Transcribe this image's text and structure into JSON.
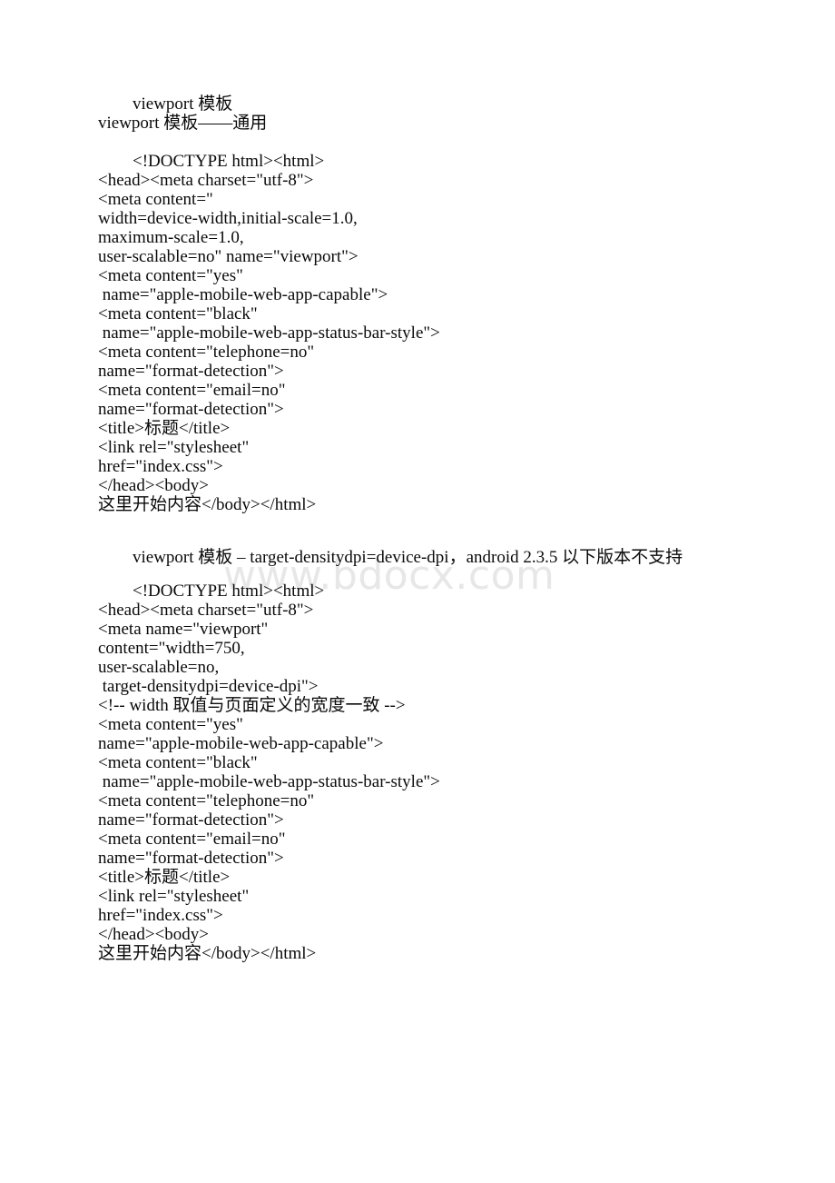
{
  "page": {
    "background": "#ffffff",
    "text_color": "#0a0a0a",
    "watermark_color": "#e7e7e7"
  },
  "watermark": {
    "text": "www.bdocx.com"
  },
  "section1": {
    "title": "viewport 模板",
    "subtitle": "viewport 模板——通用",
    "code_lines": [
      "<!DOCTYPE html><html>",
      "<head><meta charset=\"utf-8\">",
      "<meta content=\"",
      "width=device-width,initial-scale=1.0,",
      "maximum-scale=1.0,",
      "user-scalable=no\" name=\"viewport\">",
      "<meta content=\"yes\"",
      " name=\"apple-mobile-web-app-capable\">",
      "<meta content=\"black\"",
      " name=\"apple-mobile-web-app-status-bar-style\">",
      "<meta content=\"telephone=no\"",
      "name=\"format-detection\">",
      "<meta content=\"email=no\"",
      "name=\"format-detection\">",
      "<title>标题</title>",
      "<link rel=\"stylesheet\"",
      "href=\"index.css\">",
      "</head><body>",
      "这里开始内容</body></html>"
    ]
  },
  "section2": {
    "title": "viewport 模板 – target-densitydpi=device-dpi，android 2.3.5 以下版本不支持",
    "code_lines": [
      "<!DOCTYPE html><html>",
      "<head><meta charset=\"utf-8\">",
      "<meta name=\"viewport\"",
      "content=\"width=750,",
      "user-scalable=no,",
      " target-densitydpi=device-dpi\">",
      "<!-- width 取值与页面定义的宽度一致 -->",
      "<meta content=\"yes\"",
      "name=\"apple-mobile-web-app-capable\">",
      "<meta content=\"black\"",
      " name=\"apple-mobile-web-app-status-bar-style\">",
      "<meta content=\"telephone=no\"",
      "name=\"format-detection\">",
      "<meta content=\"email=no\"",
      "name=\"format-detection\">",
      "<title>标题</title>",
      "<link rel=\"stylesheet\"",
      "href=\"index.css\">",
      "</head><body>",
      "这里开始内容</body></html>"
    ]
  }
}
